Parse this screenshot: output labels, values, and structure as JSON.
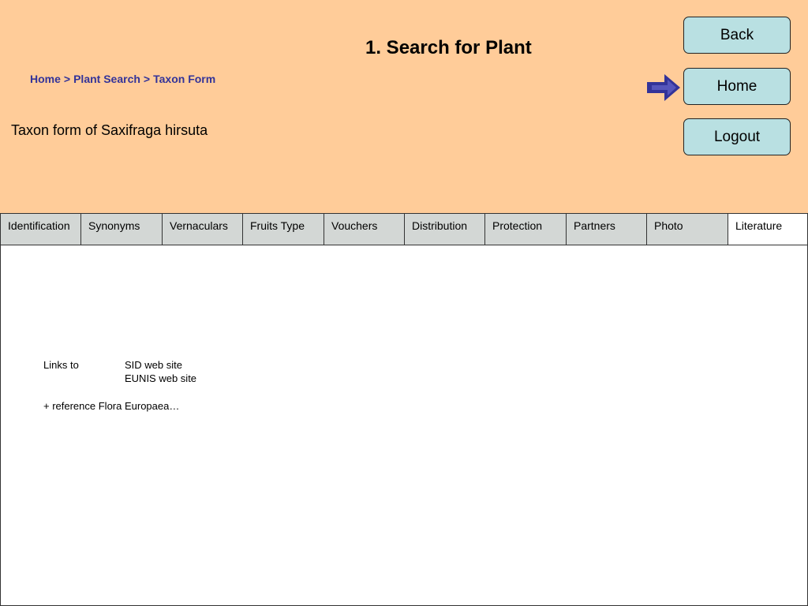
{
  "header": {
    "title": "1. Search for Plant",
    "breadcrumb": {
      "items": [
        "Home",
        "Plant Search",
        "Taxon Form"
      ],
      "separator": ">"
    },
    "taxon_title": "Taxon form of Saxifraga hirsuta",
    "background_color": "#ffcc99"
  },
  "nav": {
    "back_label": "Back",
    "home_label": "Home",
    "logout_label": "Logout",
    "button_color": "#b9e0e2",
    "arrow_icon": "arrow-right-icon",
    "arrow_color": "#333399"
  },
  "tabs": [
    {
      "label": "Identification",
      "active": false
    },
    {
      "label": "Synonyms",
      "active": false
    },
    {
      "label": "Vernaculars",
      "active": false
    },
    {
      "label": "Fruits Type",
      "active": false
    },
    {
      "label": "Vouchers",
      "active": false
    },
    {
      "label": "Distribution",
      "active": false
    },
    {
      "label": "Protection",
      "active": false
    },
    {
      "label": "Partners",
      "active": false
    },
    {
      "label": "Photo",
      "active": false
    },
    {
      "label": "Literature",
      "active": true
    }
  ],
  "content": {
    "links_label": "Links to",
    "links": [
      "SID web site",
      "EUNIS web site"
    ],
    "reference": "+ reference Flora Europaea…"
  }
}
